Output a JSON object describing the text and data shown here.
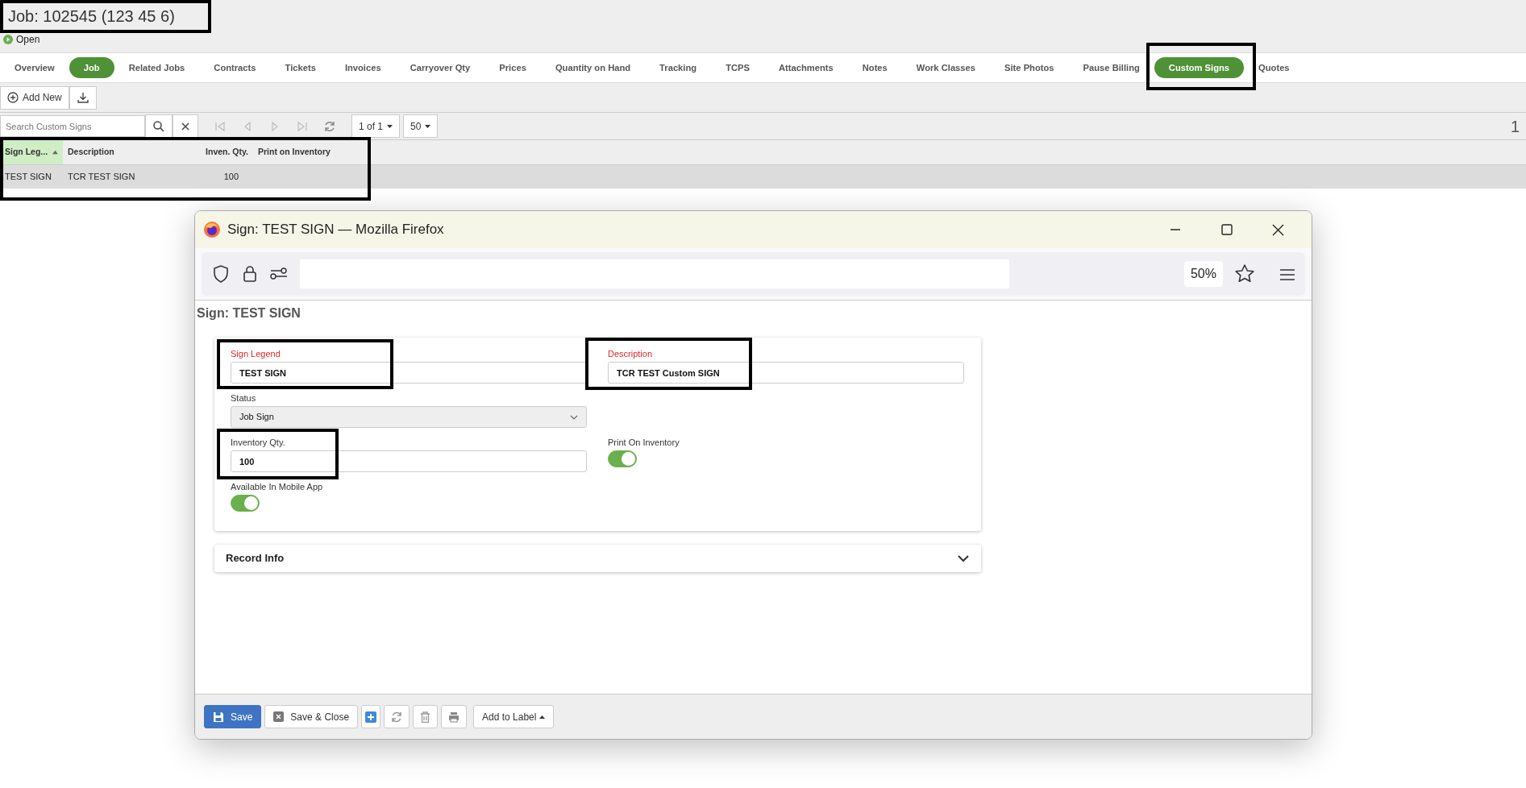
{
  "page": {
    "title": "Job: 102545 (123 45 6)",
    "status": "Open"
  },
  "tabs": [
    {
      "label": "Overview",
      "selected": false
    },
    {
      "label": "Job",
      "selected": true
    },
    {
      "label": "Related Jobs",
      "selected": false
    },
    {
      "label": "Contracts",
      "selected": false
    },
    {
      "label": "Tickets",
      "selected": false
    },
    {
      "label": "Invoices",
      "selected": false
    },
    {
      "label": "Carryover Qty",
      "selected": false
    },
    {
      "label": "Prices",
      "selected": false
    },
    {
      "label": "Quantity on Hand",
      "selected": false
    },
    {
      "label": "Tracking",
      "selected": false
    },
    {
      "label": "TCPS",
      "selected": false
    },
    {
      "label": "Attachments",
      "selected": false
    },
    {
      "label": "Notes",
      "selected": false
    },
    {
      "label": "Work Classes",
      "selected": false
    },
    {
      "label": "Site Photos",
      "selected": false
    },
    {
      "label": "Pause Billing",
      "selected": false
    },
    {
      "label": "Custom Signs",
      "selected": true
    },
    {
      "label": "Quotes",
      "selected": false
    }
  ],
  "toolbar": {
    "add_new": "Add New"
  },
  "search": {
    "placeholder": "Search Custom Signs"
  },
  "pager": {
    "page": "1 of 1",
    "page_size": "50",
    "count": "1"
  },
  "grid": {
    "columns": [
      {
        "label": "Sign Leg...",
        "sorted": true
      },
      {
        "label": "Description",
        "sorted": false
      },
      {
        "label": "Inven. Qty.",
        "sorted": false
      },
      {
        "label": "Print on Inventory",
        "sorted": false
      }
    ],
    "rows": [
      {
        "cells": [
          "TEST SIGN",
          "TCR TEST SIGN",
          "100"
        ],
        "selected": true
      }
    ]
  },
  "popup": {
    "window_title": "Sign: TEST SIGN — Mozilla Firefox",
    "zoom": "50%",
    "heading": "Sign: TEST SIGN",
    "rows": [
      [
        {
          "kind": "text",
          "label": "Sign Legend",
          "value": "TEST SIGN",
          "required": true
        },
        {
          "kind": "text",
          "label": "Description",
          "value": "TCR TEST Custom SIGN",
          "required": true
        }
      ],
      [
        {
          "kind": "select",
          "label": "Status",
          "value": "Job Sign",
          "required": false
        }
      ],
      [
        {
          "kind": "text",
          "label": "Inventory Qty.",
          "value": "100",
          "required": false
        },
        {
          "kind": "toggle",
          "label": "Print On Inventory",
          "on": true
        }
      ],
      [
        {
          "kind": "toggle",
          "label": "Available In Mobile App",
          "on": true
        }
      ]
    ],
    "record_info": {
      "title": "Record Info",
      "expanded": false
    },
    "buttons": [
      {
        "kind": "save",
        "label": "Save"
      },
      {
        "kind": "save-close",
        "label": "Save & Close"
      },
      {
        "kind": "add"
      },
      {
        "kind": "refresh"
      },
      {
        "kind": "delete"
      },
      {
        "kind": "print"
      },
      {
        "kind": "dropdown",
        "label": "Add to Label"
      }
    ]
  }
}
